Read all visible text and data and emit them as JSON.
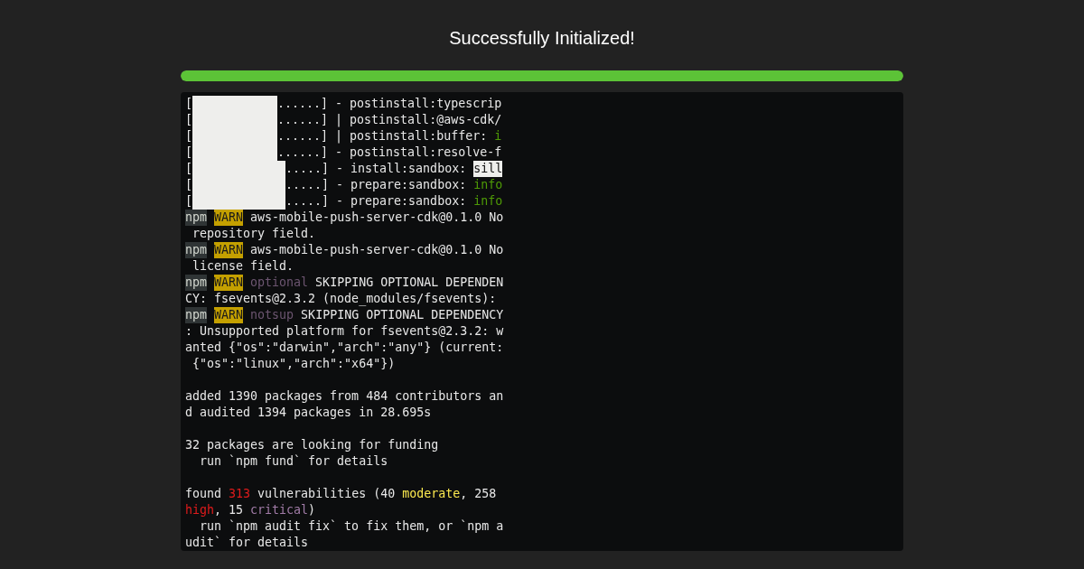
{
  "title": "Successfully Initialized!",
  "progress": {
    "level": 1
  },
  "terminal": {
    "lines": [
      {
        "kind": "short_bar",
        "segments": [
          {
            "kind": "plain",
            "text": "["
          },
          {
            "kind": "plain",
            "text": "......] - postinstall:typescrip"
          }
        ]
      },
      {
        "kind": "short_bar",
        "segments": [
          {
            "kind": "plain",
            "text": "["
          },
          {
            "kind": "plain",
            "text": "......] | postinstall:@aws-cdk/"
          }
        ]
      },
      {
        "kind": "short_bar",
        "segments": [
          {
            "kind": "plain",
            "text": "["
          },
          {
            "kind": "plain",
            "text": "......] | postinstall:buffer: "
          },
          {
            "kind": "info",
            "text": "i"
          }
        ]
      },
      {
        "kind": "short_bar",
        "segments": [
          {
            "kind": "plain",
            "text": "["
          },
          {
            "kind": "plain",
            "text": "......] - postinstall:resolve-f"
          }
        ]
      },
      {
        "kind": "long_bar",
        "segments": [
          {
            "kind": "plain",
            "text": "["
          },
          {
            "kind": "plain",
            "text": ".....] - install:sandbox: "
          },
          {
            "kind": "sill",
            "text": "sill"
          }
        ]
      },
      {
        "kind": "long_bar",
        "segments": [
          {
            "kind": "plain",
            "text": "["
          },
          {
            "kind": "plain",
            "text": ".....] - prepare:sandbox: "
          },
          {
            "kind": "info",
            "text": "info"
          }
        ]
      },
      {
        "kind": "long_bar",
        "segments": [
          {
            "kind": "plain",
            "text": "["
          },
          {
            "kind": "plain",
            "text": ".....] - prepare:sandbox: "
          },
          {
            "kind": "info",
            "text": "info"
          }
        ]
      },
      {
        "kind": "text",
        "segments": [
          {
            "kind": "npm",
            "text": "npm"
          },
          {
            "kind": "warn",
            "text": "WARN"
          },
          {
            "kind": "plain",
            "text": " aws-mobile-push-server-cdk@0.1.0 No"
          }
        ]
      },
      {
        "kind": "text",
        "segments": [
          {
            "kind": "plain",
            "text": " repository field."
          }
        ]
      },
      {
        "kind": "text",
        "segments": [
          {
            "kind": "npm",
            "text": "npm"
          },
          {
            "kind": "warn",
            "text": "WARN"
          },
          {
            "kind": "plain",
            "text": " aws-mobile-push-server-cdk@0.1.0 No"
          }
        ]
      },
      {
        "kind": "text",
        "segments": [
          {
            "kind": "plain",
            "text": " license field."
          }
        ]
      },
      {
        "kind": "text",
        "segments": [
          {
            "kind": "npm",
            "text": "npm"
          },
          {
            "kind": "warn",
            "text": "WARN"
          },
          {
            "kind": "muted",
            "text": "optional"
          },
          {
            "kind": "plain",
            "text": " SKIPPING OPTIONAL DEPENDEN"
          }
        ]
      },
      {
        "kind": "text",
        "segments": [
          {
            "kind": "plain",
            "text": "CY: fsevents@2.3.2 (node_modules/fsevents):"
          }
        ]
      },
      {
        "kind": "text",
        "segments": [
          {
            "kind": "npm",
            "text": "npm"
          },
          {
            "kind": "warn",
            "text": "WARN"
          },
          {
            "kind": "muted",
            "text": "notsup"
          },
          {
            "kind": "plain",
            "text": " SKIPPING OPTIONAL DEPENDENCY"
          }
        ]
      },
      {
        "kind": "text",
        "segments": [
          {
            "kind": "plain",
            "text": ": Unsupported platform for fsevents@2.3.2: w"
          }
        ]
      },
      {
        "kind": "text",
        "segments": [
          {
            "kind": "plain",
            "text": "anted {\"os\":\"darwin\",\"arch\":\"any\"} (current:"
          }
        ]
      },
      {
        "kind": "text",
        "segments": [
          {
            "kind": "plain",
            "text": " {\"os\":\"linux\",\"arch\":\"x64\"})"
          }
        ]
      },
      {
        "kind": "blank"
      },
      {
        "kind": "text",
        "segments": [
          {
            "kind": "plain",
            "text": "added 1390 packages from 484 contributors an"
          }
        ]
      },
      {
        "kind": "text",
        "segments": [
          {
            "kind": "plain",
            "text": "d audited 1394 packages in 28.695s"
          }
        ]
      },
      {
        "kind": "blank"
      },
      {
        "kind": "text",
        "segments": [
          {
            "kind": "plain",
            "text": "32 packages are looking for funding"
          }
        ]
      },
      {
        "kind": "text",
        "segments": [
          {
            "kind": "plain",
            "text": "  run `npm fund` for details"
          }
        ]
      },
      {
        "kind": "blank"
      },
      {
        "kind": "text",
        "segments": [
          {
            "kind": "plain",
            "text": "found "
          },
          {
            "kind": "red",
            "text": "313"
          },
          {
            "kind": "plain",
            "text": " vulnerabilities (40 "
          },
          {
            "kind": "yellow",
            "text": "moderate"
          },
          {
            "kind": "plain",
            "text": ", 258"
          }
        ]
      },
      {
        "kind": "text",
        "segments": [
          {
            "kind": "red",
            "text": "high"
          },
          {
            "kind": "plain",
            "text": ", 15 "
          },
          {
            "kind": "purple",
            "text": "critical"
          },
          {
            "kind": "plain",
            "text": ")"
          }
        ]
      },
      {
        "kind": "text",
        "segments": [
          {
            "kind": "plain",
            "text": "  run `npm audit fix` to fix them, or `npm a"
          }
        ]
      },
      {
        "kind": "text",
        "segments": [
          {
            "kind": "plain",
            "text": "udit` for details"
          }
        ]
      }
    ]
  }
}
